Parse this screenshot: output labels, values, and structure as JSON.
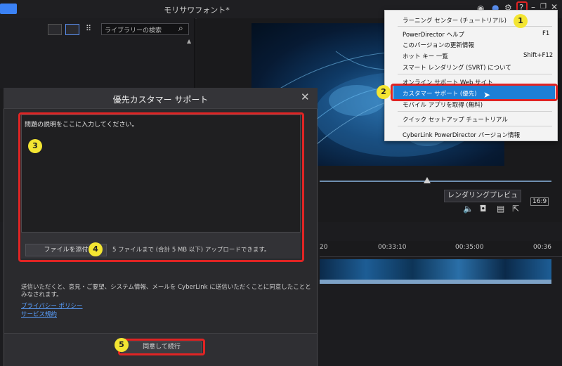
{
  "window_title": "モリサワフォント*",
  "library": {
    "search_placeholder": "ライブラリーの検索"
  },
  "preview": {
    "render_preview_label": "レンダリングプレビュー",
    "aspect_label": "16:9"
  },
  "timeline": {
    "ticks": [
      "20",
      "00:33:10",
      "00:35:00",
      "00:36"
    ]
  },
  "dialog": {
    "title": "優先カスタマー サポート",
    "close_glyph": "✕",
    "description_placeholder": "問題の説明をここに入力してください。",
    "attach_label": "ファイルを添付",
    "attach_note": "5 ファイルまで (合計 5 MB 以下) アップロードできます。",
    "consent_text": "送信いただくと、意見・ご要望、システム情報、メールを CyberLink に送信いただくことに同意したこととみなされます。",
    "privacy_link": "プライバシー ポリシー",
    "terms_link": "サービス規約",
    "agree_button": "同意して続行"
  },
  "help_menu": {
    "items": [
      {
        "label": "ラーニング センター (チュートリアル)",
        "shortcut": ""
      },
      {
        "label": "PowerDirector ヘルプ",
        "shortcut": "F1"
      },
      {
        "label": "このバージョンの更新情報",
        "shortcut": ""
      },
      {
        "label": "ホット キー 一覧",
        "shortcut": "Shift+F12"
      },
      {
        "label": "スマート レンダリング (SVRT) について",
        "shortcut": ""
      },
      {
        "label": "オンライン サポート Web サイト",
        "shortcut": ""
      },
      {
        "label": "カスタマー サポート (優先)",
        "shortcut": ""
      },
      {
        "label": "モバイル アプリを取得 (無料)",
        "shortcut": ""
      },
      {
        "label": "クイック セットアップ チュートリアル",
        "shortcut": ""
      },
      {
        "label": "CyberLink PowerDirector バージョン情報",
        "shortcut": ""
      }
    ]
  },
  "annotations": {
    "badge_1": "1",
    "badge_2": "2",
    "badge_3": "3",
    "badge_4": "4",
    "badge_5": "5",
    "highlight_color": "#e02424",
    "badge_color": "#f3e532"
  },
  "icons": [
    "user-icon",
    "info-icon",
    "gear-icon",
    "help-icon",
    "minimize-icon",
    "restore-icon",
    "close-icon",
    "grid-view-icon",
    "list-view-icon",
    "apps-icon",
    "search-icon",
    "volume-icon",
    "camera-icon",
    "subtitles-icon",
    "export-icon"
  ],
  "colors": {
    "accent_blue": "#3b82f6",
    "menu_highlight": "#1e7fd6",
    "link": "#5aa0ff"
  }
}
